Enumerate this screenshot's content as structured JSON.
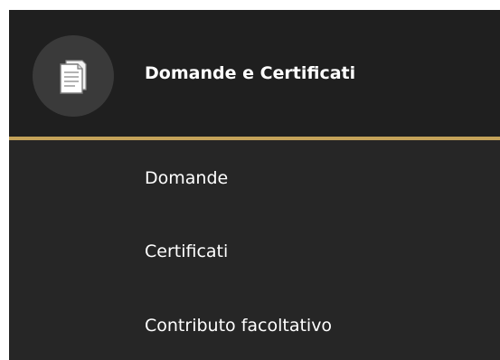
{
  "menu": {
    "header": {
      "icon": "document-icon",
      "title": "Domande e Certificati"
    },
    "items": [
      {
        "label": "Domande"
      },
      {
        "label": "Certificati"
      },
      {
        "label": "Contributo facoltativo"
      }
    ]
  },
  "colors": {
    "panel_background": "#262626",
    "header_background": "#1f1f1f",
    "icon_circle": "#3a3a3a",
    "accent_divider": "#c4a259",
    "text": "#ffffff"
  }
}
